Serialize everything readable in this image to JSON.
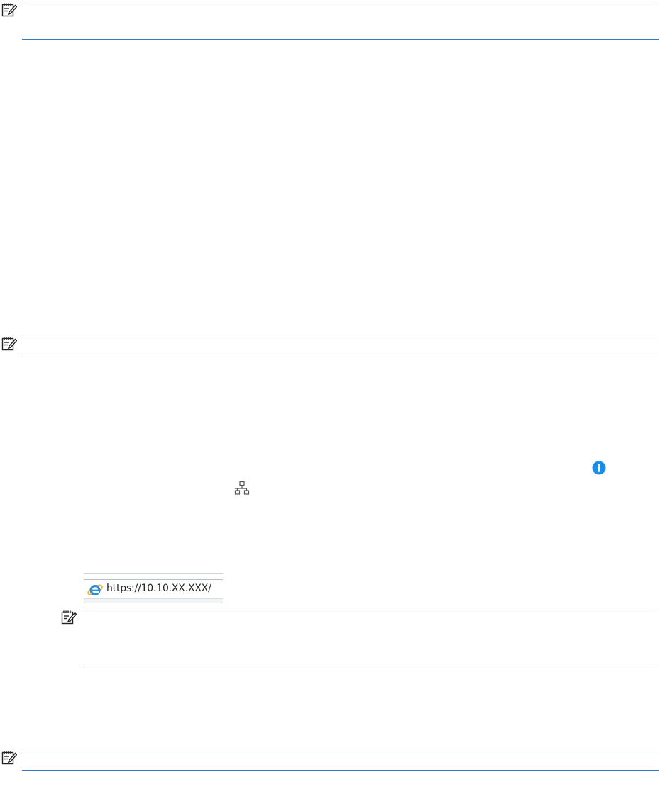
{
  "browser_address_bar": {
    "url": "https://10.10.XX.XXX/",
    "browser_icon": "internet-explorer-icon"
  },
  "icons": {
    "note": "note-icon",
    "info": "info-icon",
    "network": "network-icon"
  },
  "colors": {
    "rule": "#2e7bbf",
    "info_icon": "#1a8ee6"
  }
}
